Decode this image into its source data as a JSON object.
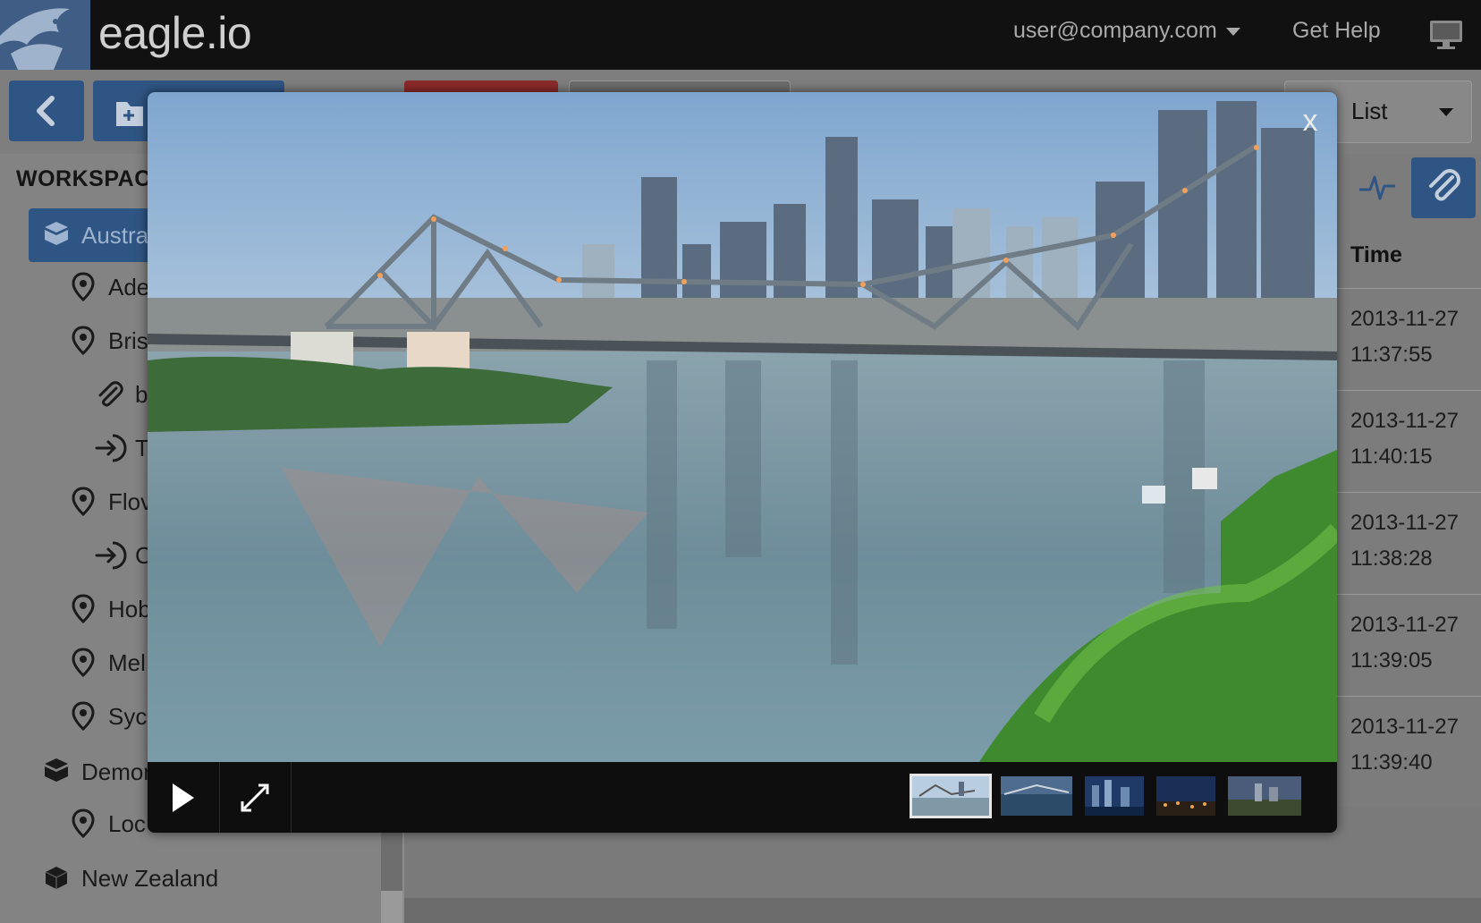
{
  "header": {
    "brand": "eagle.io",
    "user_email": "user@company.com",
    "help_label": "Get Help",
    "icons": [
      "eagle-logo",
      "chevron-down-icon",
      "monitor-icon"
    ]
  },
  "toolbar": {
    "view_select": "List",
    "icons": [
      "chevron-left-icon",
      "folder-add-icon",
      "chevron-down-icon"
    ]
  },
  "sidebar": {
    "heading": "WORKSPAC",
    "items": [
      {
        "label": "Austra",
        "icon": "workspace-icon",
        "active": true
      },
      {
        "label": "Ade",
        "icon": "location-pin-icon"
      },
      {
        "label": "Bris",
        "icon": "location-pin-icon"
      },
      {
        "label": "b",
        "icon": "paperclip-icon"
      },
      {
        "label": "T",
        "icon": "source-icon"
      },
      {
        "label": "Flov",
        "icon": "location-pin-icon"
      },
      {
        "label": "C",
        "icon": "source-icon"
      },
      {
        "label": "Hob",
        "icon": "location-pin-icon"
      },
      {
        "label": "Mel",
        "icon": "location-pin-icon"
      },
      {
        "label": "Syc",
        "icon": "location-pin-icon"
      },
      {
        "label": "Demor",
        "icon": "workspace-icon"
      },
      {
        "label": "Loc",
        "icon": "location-pin-icon"
      },
      {
        "label": "New Zealand",
        "icon": "workspace-icon"
      }
    ]
  },
  "attachments": {
    "tabs": [
      "pulse-icon",
      "paperclip-icon"
    ],
    "column_header": "Time",
    "rows": [
      {
        "date": "2013-11-27",
        "time": "11:37:55"
      },
      {
        "date": "2013-11-27",
        "time": "11:40:15"
      },
      {
        "date": "2013-11-27",
        "time": "11:38:28"
      },
      {
        "date": "2013-11-27",
        "time": "11:39:05"
      },
      {
        "date": "2013-11-27",
        "time": "11:39:40"
      }
    ]
  },
  "lightbox": {
    "close_label": "x",
    "controls": [
      "play-icon",
      "fullscreen-icon"
    ],
    "thumbnail_count": 5,
    "active_thumbnail": 1
  },
  "colors": {
    "brand_blue": "#2f5584",
    "header_bg": "#111111",
    "overlay_gray": "#838383"
  }
}
